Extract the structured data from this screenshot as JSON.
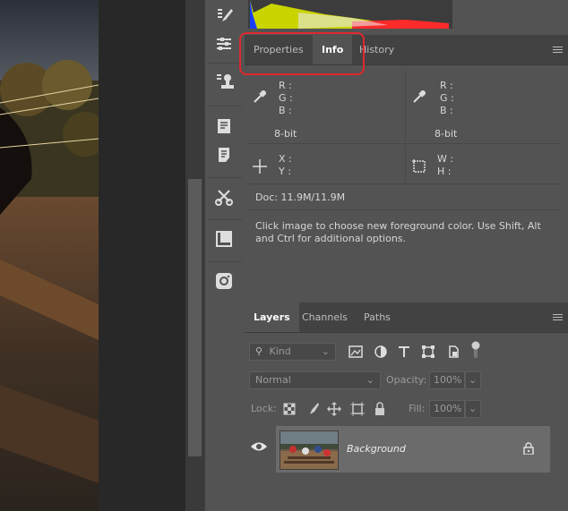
{
  "info_panel": {
    "tabs": [
      {
        "label": "Properties"
      },
      {
        "label": "Info"
      },
      {
        "label": "History"
      }
    ],
    "color_left": {
      "r": "R :",
      "g": "G :",
      "b": "B :",
      "bit": "8-bit"
    },
    "color_right": {
      "r": "R :",
      "g": "G :",
      "b": "B :",
      "bit": "8-bit"
    },
    "pos": {
      "x": "X :",
      "y": "Y :"
    },
    "size": {
      "w": "W :",
      "h": "H :"
    },
    "doc": "Doc: 11.9M/11.9M",
    "hint": "Click image to choose new foreground color.  Use Shift, Alt and Ctrl for additional options."
  },
  "layers_panel": {
    "tabs": [
      {
        "label": "Layers"
      },
      {
        "label": "Channels"
      },
      {
        "label": "Paths"
      }
    ],
    "kind_placeholder": "Kind",
    "blend_mode": "Normal",
    "opacity_label": "Opacity:",
    "opacity_value": "100%",
    "lock_label": "Lock:",
    "fill_label": "Fill:",
    "fill_value": "100%",
    "layers": [
      {
        "name": "Background"
      }
    ]
  },
  "colors": {
    "highlight": "#e0272f"
  }
}
